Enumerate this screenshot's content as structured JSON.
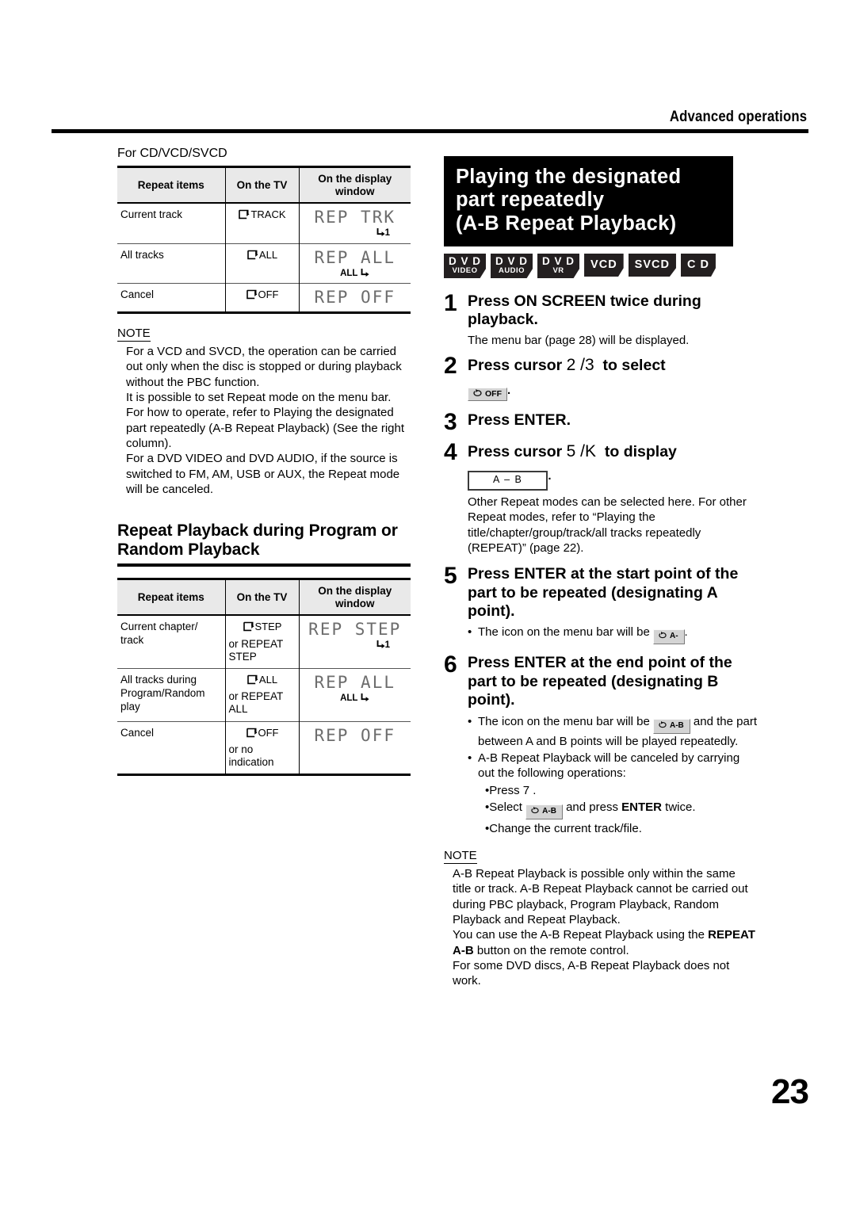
{
  "header": {
    "title": "Advanced operations"
  },
  "page_number": "23",
  "left_column": {
    "table1": {
      "caption": "For CD/VCD/SVCD",
      "columns": [
        "Repeat items",
        "On the TV",
        "On the display window"
      ],
      "rows": [
        {
          "item": "Current track",
          "tv_main": "TRACK",
          "tv_sub": "",
          "display": "REP TRK",
          "display_sub": "1",
          "display_sub_pos": "right"
        },
        {
          "item": "All tracks",
          "tv_main": "ALL",
          "tv_sub": "",
          "display": "REP ALL",
          "display_sub": "ALL",
          "display_sub_pos": "left"
        },
        {
          "item": "Cancel",
          "tv_main": "OFF",
          "tv_sub": "",
          "display": "REP OFF",
          "display_sub": "",
          "display_sub_pos": ""
        }
      ]
    },
    "note1": {
      "label": "NOTE",
      "paragraphs": [
        "For a VCD and SVCD, the operation can be carried out only when the disc is stopped or during playback without the PBC function.",
        "It is possible to set Repeat mode on the menu bar. For how to operate, refer to  Playing the designated part repeatedly (A-B Repeat Playback)  (See the right column).",
        "For a DVD VIDEO and DVD AUDIO, if the source is switched to FM, AM, USB or AUX, the Repeat mode will be canceled."
      ]
    },
    "section_heading": "Repeat Playback during Program or Random Playback",
    "table2": {
      "columns": [
        "Repeat items",
        "On the TV",
        "On the display window"
      ],
      "rows": [
        {
          "item": "Current chapter/ track",
          "tv_main": "STEP",
          "tv_sub": "or REPEAT STEP",
          "display": "REP STEP",
          "display_sub": "1",
          "display_sub_pos": "right"
        },
        {
          "item": "All tracks during Program/Random play",
          "tv_main": "ALL",
          "tv_sub": "or REPEAT ALL",
          "display": "REP ALL",
          "display_sub": "ALL",
          "display_sub_pos": "left"
        },
        {
          "item": "Cancel",
          "tv_main": "OFF",
          "tv_sub": "or no indication",
          "display": "REP OFF",
          "display_sub": "",
          "display_sub_pos": ""
        }
      ]
    }
  },
  "right_column": {
    "banner": {
      "line1": "Playing the designated",
      "line2": "part repeatedly",
      "line3": "(A-B Repeat Playback)"
    },
    "badges": [
      {
        "top": "D V D",
        "bottom": "VIDEO"
      },
      {
        "top": "D V D",
        "bottom": "AUDIO"
      },
      {
        "top": "D V D",
        "bottom": "VR"
      },
      {
        "top": "VCD",
        "bottom": ""
      },
      {
        "top": "SVCD",
        "bottom": ""
      },
      {
        "top": "C D",
        "bottom": ""
      }
    ],
    "steps": [
      {
        "num": "1",
        "title": "Press ON SCREEN twice during playback.",
        "body": [
          "The menu bar (page 28) will be displayed."
        ]
      },
      {
        "num": "2",
        "title_pre": "Press cursor",
        "title_keys": "2 /3",
        "title_post": "to select",
        "pill_label": "OFF",
        "trailing": "."
      },
      {
        "num": "3",
        "title": "Press ENTER."
      },
      {
        "num": "4",
        "title_pre": "Press cursor",
        "title_keys": "5 /K",
        "title_post": "to display",
        "box_label": "A – B",
        "trailing": ".",
        "body": [
          "Other Repeat modes can be selected here. For other Repeat modes, refer to “Playing the title/chapter/group/track/all tracks repeatedly (REPEAT)” (page 22)."
        ]
      },
      {
        "num": "5",
        "title": "Press ENTER at the start point of the part to be repeated (designating A point).",
        "bullet_pre": "The icon on the menu bar will be",
        "bullet_pill": "A-",
        "bullet_post": "."
      },
      {
        "num": "6",
        "title": "Press ENTER at the end point of the part to be repeated (designating B point).",
        "bullet1_pre": "The icon on the menu bar will be",
        "bullet1_pill": "A-B",
        "bullet1_post": "and the part between A and B points will be played repeatedly.",
        "bullet2": "A-B Repeat Playback will be canceled by carrying out the following operations:",
        "subbullets": [
          {
            "text": "Press 7 ."
          },
          {
            "pre": "Select",
            "pill": "A-B",
            "mid": "and press",
            "bold": "ENTER",
            "post": "twice."
          },
          {
            "text": "Change the current track/file."
          }
        ]
      }
    ],
    "note2": {
      "label": "NOTE",
      "paragraphs": [
        "A-B Repeat Playback is possible only within the same title or track. A-B Repeat Playback cannot be carried out during PBC playback, Program Playback, Random Playback and Repeat Playback.",
        "You can use the A-B Repeat Playback using the REPEAT A-B button on the remote control.",
        "For some DVD discs, A-B Repeat Playback does not work."
      ],
      "bold_phrase": "REPEAT A-B"
    }
  }
}
